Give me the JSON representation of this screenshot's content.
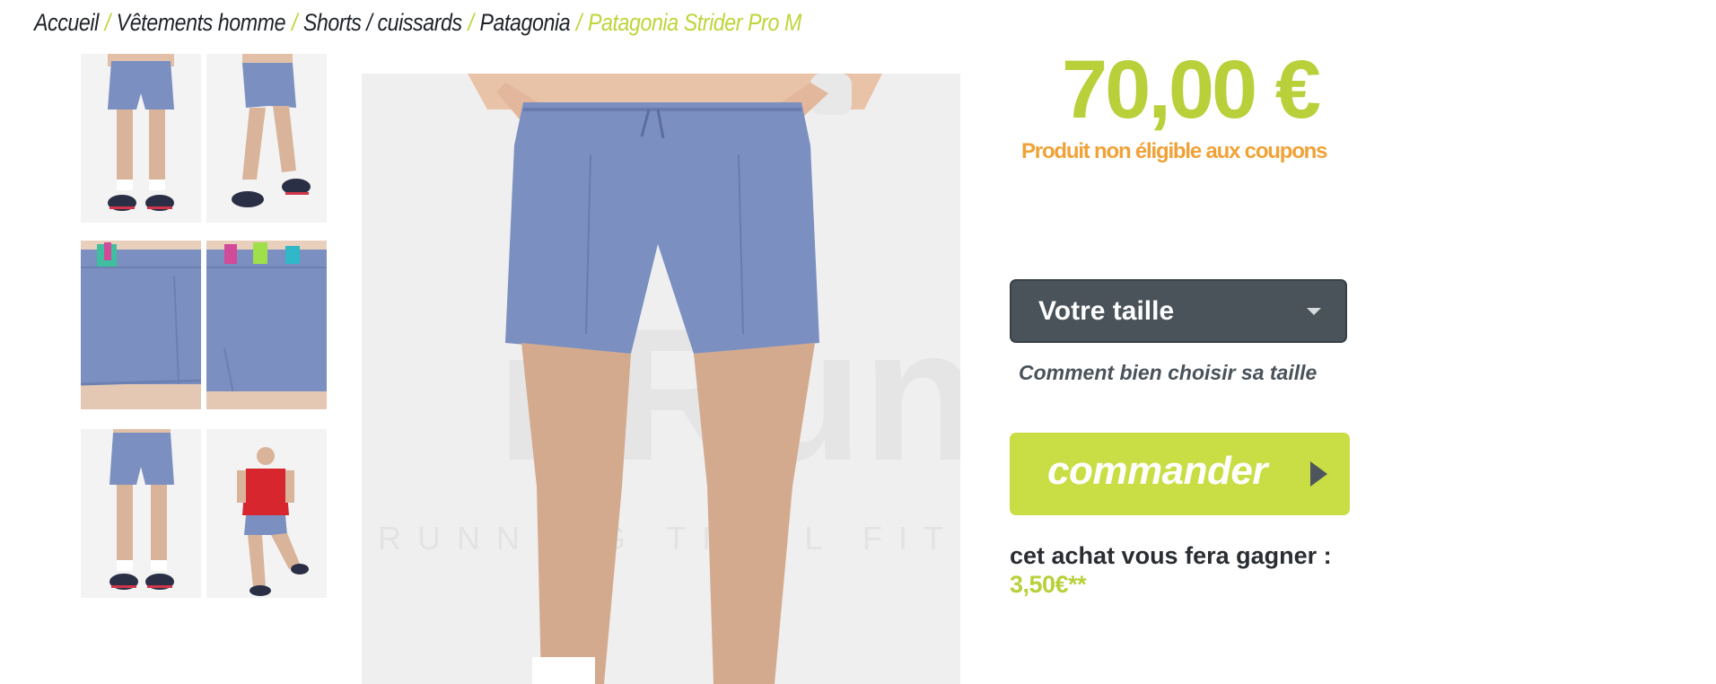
{
  "breadcrumb": {
    "items": [
      "Accueil",
      "Vêtements homme",
      "Shorts / cuissards",
      "Patagonia"
    ],
    "separator": "/",
    "current": "Patagonia Strider Pro M"
  },
  "product": {
    "price": "70,00 €",
    "coupon_note": "Produit non éligible aux coupons",
    "size_select": {
      "selected": "Votre taille"
    },
    "size_guide_link": "Comment bien choisir sa taille",
    "order_button": "commander",
    "reward_label": "cet achat vous fera gagner :",
    "reward_value": "3,50€**"
  },
  "gallery": {
    "thumbnails": [
      "front-standing",
      "side-walking",
      "back-pockets-left",
      "back-pockets-right",
      "front-legs",
      "red-shirt-pose"
    ],
    "main_image": "front-closeup",
    "watermark_text": "RUNNING TRAIL FITNESS",
    "watermark_logo": "i-Run.fr"
  },
  "colors": {
    "accent_green": "#b9d03b",
    "button_green": "#c9dd45",
    "coupon_orange": "#f0a238",
    "select_dark": "#4a525a",
    "shorts_blue": "#7b8fc0"
  },
  "icons": {
    "size_caret": "chevron-down-icon",
    "order_arrow": "play-arrow-icon"
  }
}
